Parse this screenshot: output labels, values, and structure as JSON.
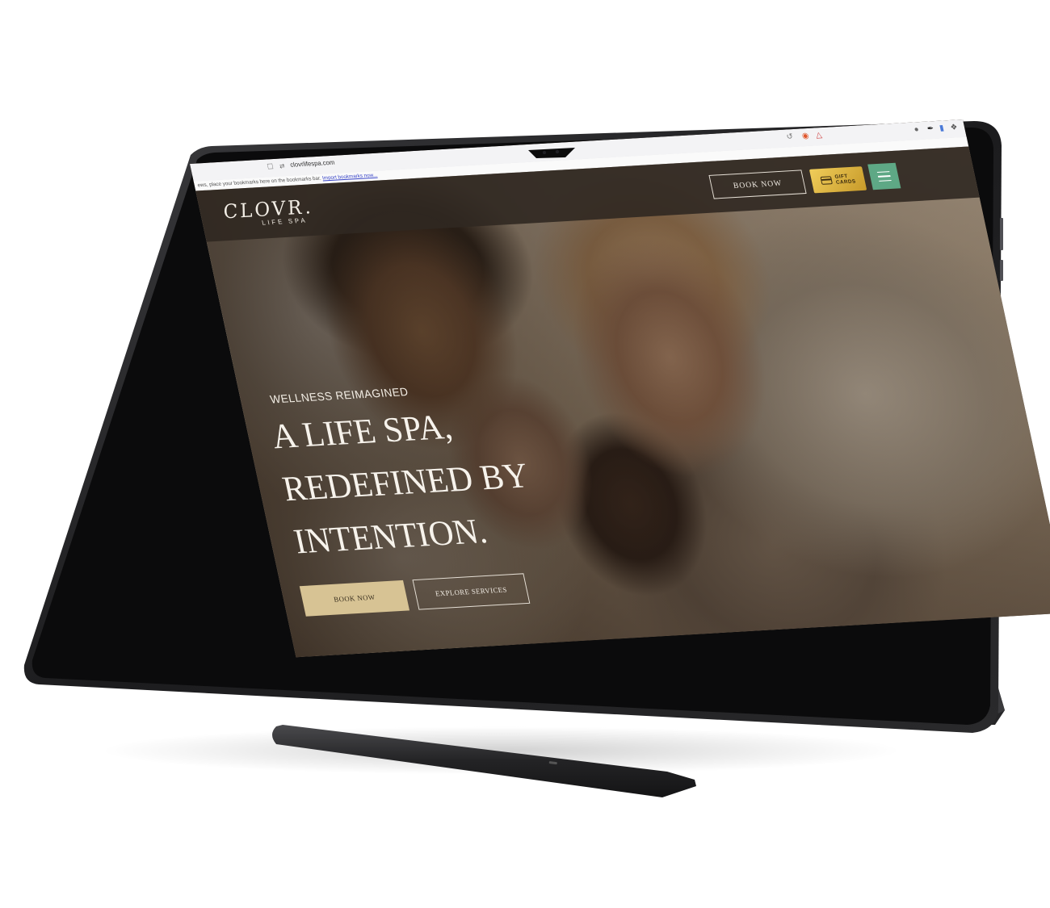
{
  "browser": {
    "url": "clovrlifespa.com",
    "bookmarks_hint": "ews, place your bookmarks here on the bookmarks bar.",
    "bookmarks_link": "Import bookmarks now..."
  },
  "header": {
    "logo_main": "CLOVR.",
    "logo_sub": "LIFE SPA",
    "book_label": "BOOK NOW",
    "gift_line1": "GIFT",
    "gift_line2": "CARDS"
  },
  "hero": {
    "eyebrow": "WELLNESS REIMAGINED",
    "headline_lines": [
      "A LIFE SPA,",
      "REDEFINED BY",
      "INTENTION."
    ],
    "book_label": "BOOK NOW",
    "explore_label": "EXPLORE SERVICES"
  },
  "colors": {
    "header_bg": "#30281f",
    "gift_gold": "#d9b445",
    "menu_green": "#5ea885",
    "book_button": "#d7c394",
    "device_body": "#1c1c1e"
  }
}
